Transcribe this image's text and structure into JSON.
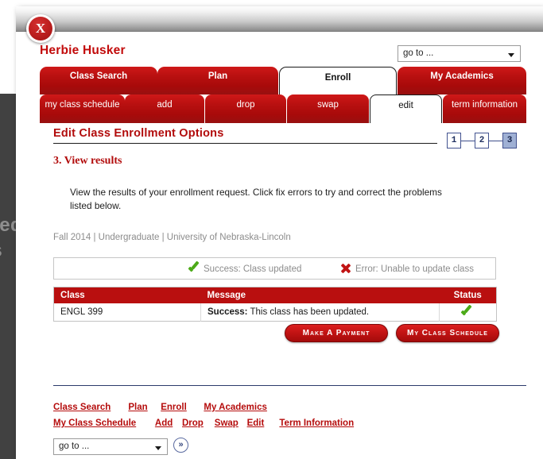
{
  "backdrop": {
    "line1": "Related",
    "line2": "Links"
  },
  "modal": {
    "close_label": "X"
  },
  "header": {
    "user_name": "Herbie Husker",
    "goto_select_value": "go to ...",
    "goto_arrow_icon": "chevron-down-icon"
  },
  "tabs_primary": [
    {
      "label": "Class Search",
      "active": false
    },
    {
      "label": "Plan",
      "active": false
    },
    {
      "label": "Enroll",
      "active": true
    },
    {
      "label": "My Academics",
      "active": false
    }
  ],
  "tabs_secondary": [
    {
      "label": "my class schedule",
      "active": false
    },
    {
      "label": "add",
      "active": false
    },
    {
      "label": "drop",
      "active": false
    },
    {
      "label": "swap",
      "active": false
    },
    {
      "label": "edit",
      "active": true
    },
    {
      "label": "term information",
      "active": false
    }
  ],
  "page": {
    "title": "Edit Class Enrollment Options",
    "step_heading": "3. View results",
    "instructions": "View the results of your enrollment request.  Click fix errors to try and correct the problems listed below.",
    "context": "Fall 2014 | Undergraduate | University of Nebraska-Lincoln"
  },
  "steps": [
    {
      "label": "1",
      "current": false
    },
    {
      "label": "2",
      "current": false
    },
    {
      "label": "3",
      "current": true
    }
  ],
  "legend": {
    "success_icon": "green-check-icon",
    "success_text": "Success:  Class updated",
    "error_icon": "red-x-icon",
    "error_text": "Error: Unable to update class"
  },
  "results": {
    "columns": [
      "Class",
      "Message",
      "Status"
    ],
    "rows": [
      {
        "class": "ENGL  399",
        "message_label": "Success:",
        "message_text": " This class has been updated.",
        "status_icon": "green-check-icon"
      }
    ]
  },
  "actions": {
    "make_payment": "Make A Payment",
    "my_class_schedule": "My Class Schedule"
  },
  "footer": {
    "row1": [
      "Class Search",
      "Plan",
      "Enroll",
      "My Academics"
    ],
    "row2": [
      "My Class Schedule",
      "Add",
      "Drop",
      "Swap",
      "Edit",
      "Term Information"
    ],
    "goto_select_value": "go to ...",
    "go_button_label": "»"
  },
  "colors": {
    "brand_red": "#b50c0c",
    "tab_red": "#b81010",
    "table_header_red": "#b90f0f",
    "success_green": "#4caa18",
    "error_red": "#c11414",
    "step_current": "#9fb0d4",
    "footer_rule": "#2b3a6b"
  }
}
